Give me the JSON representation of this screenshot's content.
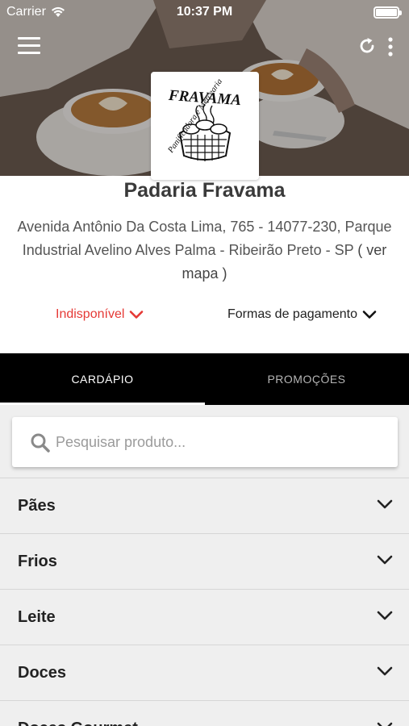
{
  "status_bar": {
    "carrier": "Carrier",
    "time": "10:37 PM"
  },
  "header": {
    "icons": [
      "menu-icon",
      "refresh-icon",
      "more-vertical-icon"
    ]
  },
  "store": {
    "logo_text": "FRAVAMA",
    "logo_subtitle": "Panificadora e Mercearia",
    "name": "Padaria Fravama",
    "address": "Avenida Antônio Da Costa Lima, 765 - 14077-230, Parque Industrial Avelino Alves Palma - Ribeirão Preto - SP",
    "map_link": "( ver mapa )",
    "availability": "Indisponível",
    "payment_label": "Formas de pagamento"
  },
  "tabs": [
    {
      "label": "CARDÁPIO",
      "active": true
    },
    {
      "label": "PROMOÇÕES",
      "active": false
    }
  ],
  "search": {
    "placeholder": "Pesquisar produto...",
    "value": ""
  },
  "categories": [
    {
      "label": "Pães"
    },
    {
      "label": "Frios"
    },
    {
      "label": "Leite"
    },
    {
      "label": "Doces"
    },
    {
      "label": "Doces Gourmet"
    }
  ],
  "colors": {
    "accent_red": "#e53935",
    "tab_bar": "#000000",
    "background": "#efefef"
  }
}
